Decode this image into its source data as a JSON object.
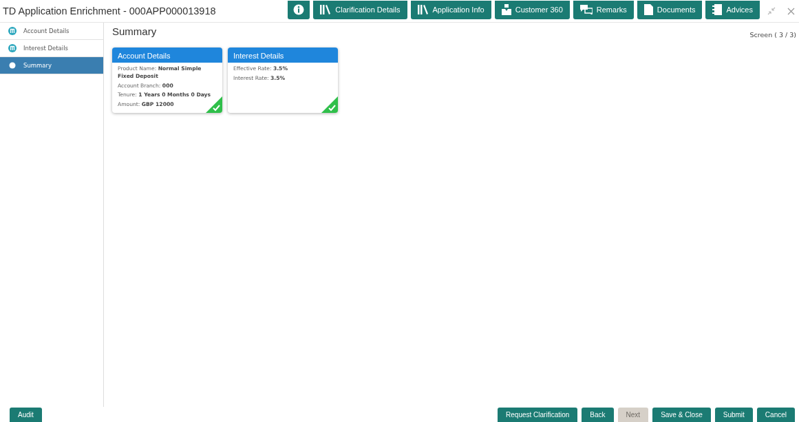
{
  "window": {
    "title": "TD Application Enrichment - 000APP000013918"
  },
  "toolbar": [
    {
      "kind": "info"
    },
    {
      "kind": "books",
      "label": "Clarification Details"
    },
    {
      "kind": "books",
      "label": "Application Info"
    },
    {
      "kind": "person",
      "label": "Customer 360"
    },
    {
      "kind": "chat",
      "label": "Remarks"
    },
    {
      "kind": "doc",
      "label": "Documents"
    },
    {
      "kind": "notebook",
      "label": "Advices"
    }
  ],
  "sidebar": {
    "items": [
      {
        "label": "Account Details",
        "selected": false,
        "completed": true
      },
      {
        "label": "Interest Details",
        "selected": false,
        "completed": true
      },
      {
        "label": "Summary",
        "selected": true,
        "completed": false
      }
    ]
  },
  "page": {
    "title": "Summary",
    "screen": "Screen ( 3 / 3)"
  },
  "cards": [
    {
      "title": "Account Details",
      "complete": true,
      "lines": [
        "Product Name: **Normal Simple Fixed Deposit**",
        "Account Branch: **000**",
        "Tenure: **1 Years 0 Months 0 Days**",
        "Amount: **GBP 12000**"
      ]
    },
    {
      "title": "Interest Details",
      "complete": true,
      "lines": [
        "Effective Rate: **3.5%**",
        "Interest Rate: **3.5%**"
      ]
    }
  ],
  "footer": {
    "left": [
      {
        "label": "Audit",
        "disabled": false
      }
    ],
    "right": [
      {
        "label": "Request Clarification",
        "disabled": false
      },
      {
        "label": "Back",
        "disabled": false
      },
      {
        "label": "Next",
        "disabled": true
      },
      {
        "label": "Save & Close",
        "disabled": false
      },
      {
        "label": "Submit",
        "disabled": false
      },
      {
        "label": "Cancel",
        "disabled": false
      }
    ]
  }
}
